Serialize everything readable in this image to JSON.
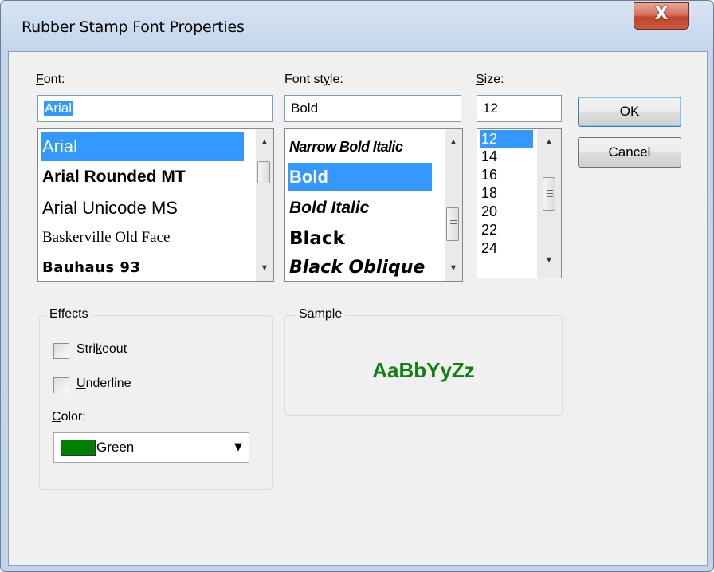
{
  "window": {
    "title": "Rubber Stamp Font Properties",
    "close_glyph": "X"
  },
  "font": {
    "label_prefix": "",
    "label_mnemonic": "F",
    "label_rest": "ont:",
    "value": "Arial",
    "items": [
      "Arial",
      "Arial Rounded MT",
      "Arial Unicode MS",
      "Baskerville Old Face",
      "Bauhaus 93"
    ],
    "selected_index": 0
  },
  "style": {
    "label_prefix": "Font st",
    "label_mnemonic": "y",
    "label_rest": "le:",
    "value": "Bold",
    "items": [
      "Narrow Bold Italic",
      "Bold",
      "Bold Italic",
      "Black",
      "Black Oblique"
    ],
    "selected_index": 1
  },
  "size": {
    "label_prefix": "",
    "label_mnemonic": "S",
    "label_rest": "ize:",
    "value": "12",
    "items": [
      "12",
      "14",
      "16",
      "18",
      "20",
      "22",
      "24"
    ],
    "selected_index": 0
  },
  "buttons": {
    "ok": "OK",
    "cancel": "Cancel"
  },
  "effects": {
    "title": "Effects",
    "strikeout_prefix": "Stri",
    "strikeout_mnemonic": "k",
    "strikeout_rest": "eout",
    "strikeout_checked": false,
    "underline_prefix": "",
    "underline_mnemonic": "U",
    "underline_rest": "nderline",
    "underline_checked": false,
    "color_prefix": "",
    "color_mnemonic": "C",
    "color_rest": "olor:",
    "color_value": "Green",
    "color_swatch": "#007f00"
  },
  "sample": {
    "title": "Sample",
    "text": "AaBbYyZz",
    "color": "#0e7f10"
  },
  "icons": {
    "scroll_up": "▲",
    "scroll_down": "▼",
    "dropdown": "▼"
  }
}
